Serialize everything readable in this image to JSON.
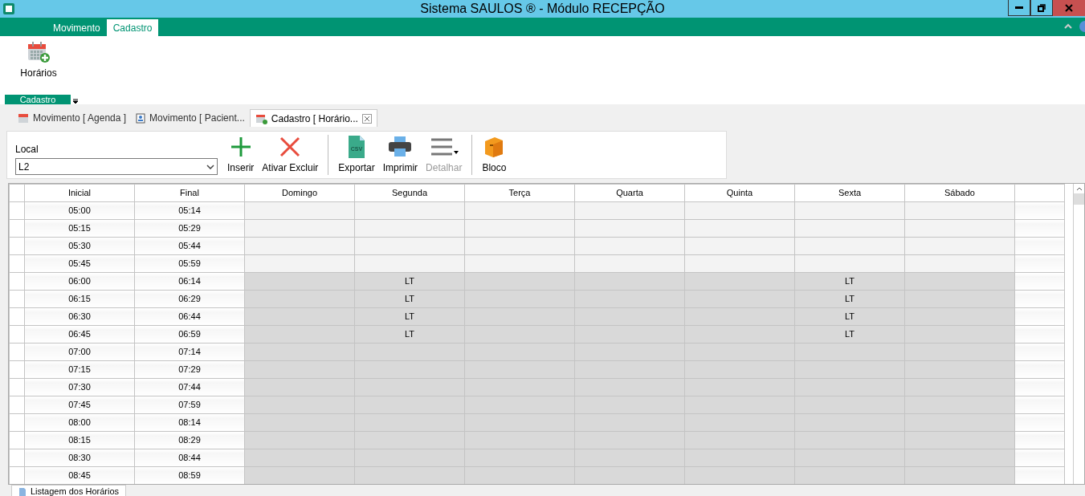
{
  "window": {
    "title": "Sistema SAULOS ® - Módulo RECEPÇÃO"
  },
  "ribbon_tabs": [
    {
      "label": "Movimento",
      "selected": false
    },
    {
      "label": "Cadastro",
      "selected": true
    }
  ],
  "ribbon": {
    "buttons": [
      {
        "label": "Horários"
      }
    ],
    "group_label": "Cadastro"
  },
  "document_tabs": [
    {
      "label": "Movimento [ Agenda ]",
      "kind": "calendar",
      "selected": false,
      "closable": false
    },
    {
      "label": "Movimento [ Pacient...",
      "kind": "badge",
      "selected": false,
      "closable": false
    },
    {
      "label": "Cadastro [ Horário...",
      "kind": "calendar-add",
      "selected": true,
      "closable": true
    }
  ],
  "toolbar": {
    "local_label": "Local",
    "local_value": "L2",
    "buttons": [
      {
        "label": "Inserir",
        "kind": "plus",
        "disabled": false
      },
      {
        "label": "Ativar Excluir",
        "kind": "cross",
        "disabled": false
      },
      {
        "kind": "separator"
      },
      {
        "label": "Exportar",
        "kind": "csv",
        "icon_text": "CSV",
        "disabled": false
      },
      {
        "label": "Imprimir",
        "kind": "printer",
        "disabled": false
      },
      {
        "label": "Detalhar",
        "kind": "lines",
        "disabled": true
      },
      {
        "kind": "separator"
      },
      {
        "label": "Bloco",
        "kind": "box",
        "disabled": false
      }
    ]
  },
  "table": {
    "columns": [
      "Inicial",
      "Final",
      "Domingo",
      "Segunda",
      "Terça",
      "Quarta",
      "Quinta",
      "Sexta",
      "Sábado"
    ],
    "rows": [
      {
        "start": "05:00",
        "end": "05:14",
        "shaded": false,
        "cells": [
          null,
          null,
          null,
          null,
          null,
          null,
          null
        ]
      },
      {
        "start": "05:15",
        "end": "05:29",
        "shaded": false,
        "cells": [
          null,
          null,
          null,
          null,
          null,
          null,
          null
        ]
      },
      {
        "start": "05:30",
        "end": "05:44",
        "shaded": false,
        "cells": [
          null,
          null,
          null,
          null,
          null,
          null,
          null
        ]
      },
      {
        "start": "05:45",
        "end": "05:59",
        "shaded": false,
        "cells": [
          null,
          null,
          null,
          null,
          null,
          null,
          null
        ]
      },
      {
        "start": "06:00",
        "end": "06:14",
        "shaded": true,
        "cells": [
          null,
          "LT",
          null,
          null,
          null,
          "LT",
          null
        ]
      },
      {
        "start": "06:15",
        "end": "06:29",
        "shaded": true,
        "cells": [
          null,
          "LT",
          null,
          null,
          null,
          "LT",
          null
        ]
      },
      {
        "start": "06:30",
        "end": "06:44",
        "shaded": true,
        "cells": [
          null,
          "LT",
          null,
          null,
          null,
          "LT",
          null
        ]
      },
      {
        "start": "06:45",
        "end": "06:59",
        "shaded": true,
        "cells": [
          null,
          "LT",
          null,
          null,
          null,
          "LT",
          null
        ]
      },
      {
        "start": "07:00",
        "end": "07:14",
        "shaded": true,
        "cells": [
          null,
          null,
          null,
          null,
          null,
          null,
          null
        ]
      },
      {
        "start": "07:15",
        "end": "07:29",
        "shaded": true,
        "cells": [
          null,
          null,
          null,
          null,
          null,
          null,
          null
        ]
      },
      {
        "start": "07:30",
        "end": "07:44",
        "shaded": true,
        "cells": [
          null,
          null,
          null,
          null,
          null,
          null,
          null
        ]
      },
      {
        "start": "07:45",
        "end": "07:59",
        "shaded": true,
        "cells": [
          null,
          null,
          null,
          null,
          null,
          null,
          null
        ]
      },
      {
        "start": "08:00",
        "end": "08:14",
        "shaded": true,
        "cells": [
          null,
          null,
          null,
          null,
          null,
          null,
          null
        ]
      },
      {
        "start": "08:15",
        "end": "08:29",
        "shaded": true,
        "cells": [
          null,
          null,
          null,
          null,
          null,
          null,
          null
        ]
      },
      {
        "start": "08:30",
        "end": "08:44",
        "shaded": true,
        "cells": [
          null,
          null,
          null,
          null,
          null,
          null,
          null
        ]
      },
      {
        "start": "08:45",
        "end": "08:59",
        "shaded": true,
        "cells": [
          null,
          null,
          null,
          null,
          null,
          null,
          null
        ]
      }
    ]
  },
  "bottom_tabs": [
    {
      "label": "Listagem dos Horários",
      "selected": true
    }
  ]
}
